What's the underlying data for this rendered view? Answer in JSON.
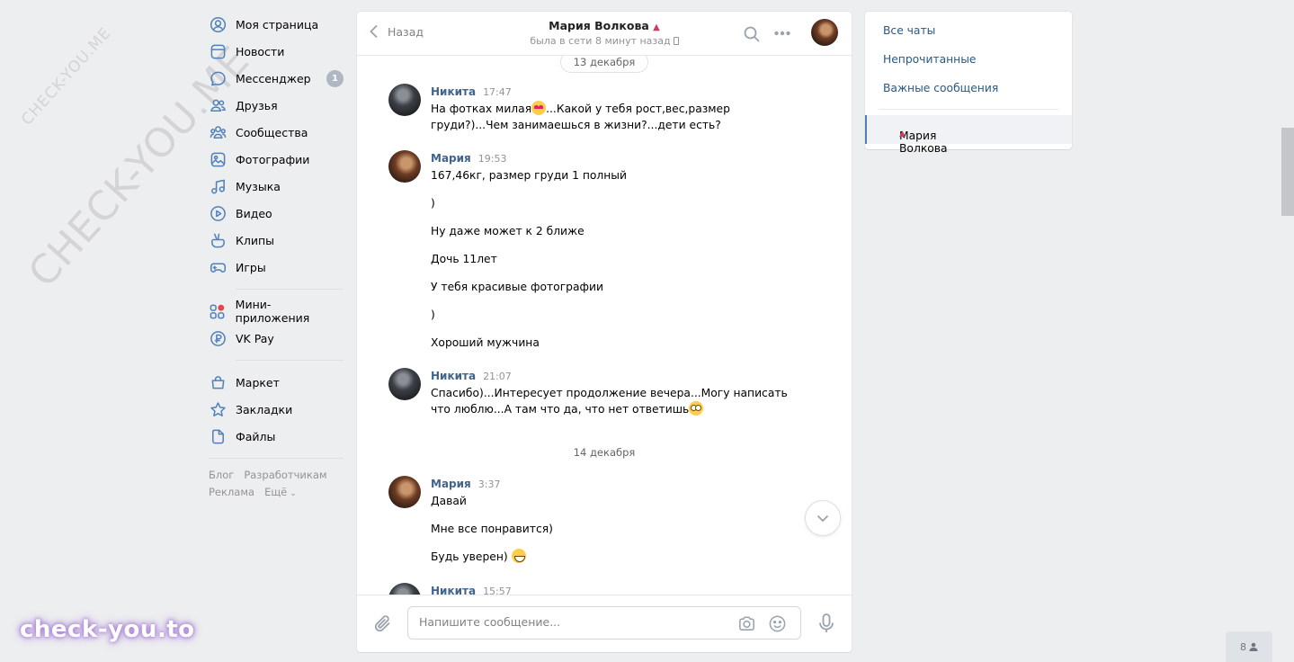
{
  "watermark": {
    "small": "CHECK-YOU.ME",
    "large": "CHECK-YOU.ME",
    "bottom": "check-you.to"
  },
  "sidebar": {
    "items": [
      {
        "label": "Моя страница",
        "icon": "user-icon"
      },
      {
        "label": "Новости",
        "icon": "news-icon"
      },
      {
        "label": "Мессенджер",
        "icon": "messenger-icon",
        "badge": "1"
      },
      {
        "label": "Друзья",
        "icon": "friends-icon"
      },
      {
        "label": "Сообщества",
        "icon": "communities-icon"
      },
      {
        "label": "Фотографии",
        "icon": "photos-icon"
      },
      {
        "label": "Музыка",
        "icon": "music-icon"
      },
      {
        "label": "Видео",
        "icon": "video-icon"
      },
      {
        "label": "Клипы",
        "icon": "clips-icon"
      },
      {
        "label": "Игры",
        "icon": "games-icon"
      },
      {
        "label": "Мини-приложения",
        "icon": "mini-apps-icon"
      },
      {
        "label": "VK Pay",
        "icon": "vk-pay-icon"
      },
      {
        "label": "Маркет",
        "icon": "market-icon"
      },
      {
        "label": "Закладки",
        "icon": "bookmarks-icon"
      },
      {
        "label": "Файлы",
        "icon": "files-icon"
      }
    ],
    "footer": [
      "Блог",
      "Разработчикам",
      "Реклама",
      "Ещё"
    ]
  },
  "chat": {
    "back_label": "Назад",
    "peer_name": "Мария Волкова",
    "peer_status": "была в сети 8 минут назад",
    "date1": "13 декабря",
    "date2": "14 декабря",
    "messages": [
      {
        "author": "Никита",
        "time": "17:47",
        "lines": [
          "На фотках милая",
          "...Какой у тебя рост,вес,размер",
          "груди?)...Чем занимаешься в жизни?...дети есть?"
        ]
      },
      {
        "author": "Мария",
        "time": "19:53",
        "lines": [
          "167,46кг, размер груди 1 полный",
          ")",
          "Ну даже может к 2 ближе",
          "Дочь 11лет",
          "У тебя красивые фотографии",
          ")",
          "Хороший мужчина"
        ]
      },
      {
        "author": "Никита",
        "time": "21:07",
        "lines": [
          "Спасибо)...Интересует продолжение вечера...Могу написать",
          "что люблю...А там что да, что нет ответишь"
        ]
      },
      {
        "author": "Мария",
        "time": "3:37",
        "lines": [
          "Давай",
          "Мне все понравится)",
          "Будь уверен) "
        ]
      },
      {
        "author": "Никита",
        "time": "15:57",
        "lines": []
      }
    ],
    "input_placeholder": "Напишите сообщение..."
  },
  "right_panel": {
    "all_chats": "Все чаты",
    "unread": "Непрочитанные",
    "important": "Важные сообщения",
    "active_chat": "Мария Волкова"
  },
  "online_count": "8"
}
